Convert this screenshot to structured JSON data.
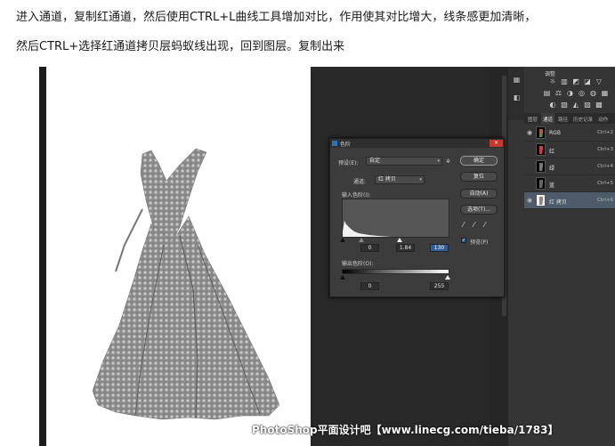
{
  "instructions": {
    "line1": "进入通道，复制红通道，然后使用CTRL+L曲线工具增加对比，作用使其对比增大，线条感更加清晰，",
    "line2": "然后CTRL+选择红通道拷贝层蚂蚁线出现，回到图层。复制出来"
  },
  "adjustments_panel": {
    "title": "调整"
  },
  "panel_tabs": [
    "图层",
    "通道",
    "路径",
    "历史记录",
    "动作"
  ],
  "channels": [
    {
      "name": "RGB",
      "shortcut": "Ctrl+2"
    },
    {
      "name": "红",
      "shortcut": "Ctrl+3"
    },
    {
      "name": "绿",
      "shortcut": "Ctrl+4"
    },
    {
      "name": "蓝",
      "shortcut": "Ctrl+5"
    },
    {
      "name": "红 拷贝",
      "shortcut": "Ctrl+6"
    }
  ],
  "levels_dialog": {
    "title": "色阶",
    "preset_label": "预设(E):",
    "preset_value": "自定",
    "channel_label": "通道:",
    "channel_value": "红 拷贝",
    "input_label": "输入色阶(I):",
    "input_black": "0",
    "input_gamma": "1.84",
    "input_white": "130",
    "output_label": "输出色阶(O):",
    "output_black": "0",
    "output_white": "255",
    "buttons": {
      "ok": "确定",
      "reset": "复位",
      "auto": "自动(A)",
      "options": "选项(T)..."
    },
    "preview_label": "预览(P)",
    "preview_checked": true,
    "close": "×"
  },
  "watermark": "PhotoShop平面设计吧【www.linecg.com/tieba/1783】",
  "colors": {
    "workspace": "#282828",
    "panel": "#353535",
    "selected_row": "#4d5b6a",
    "close_button": "#c43a2f"
  }
}
